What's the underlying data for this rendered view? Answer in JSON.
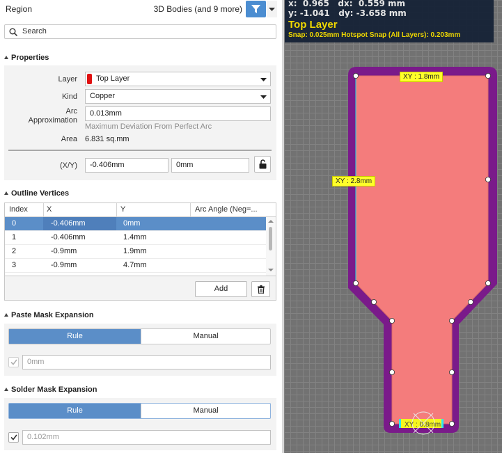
{
  "header": {
    "title": "Region",
    "filter_text": "3D Bodies (and 9 more)",
    "filter_icon": "funnel-icon"
  },
  "search": {
    "placeholder": "Search"
  },
  "properties": {
    "section_label": "Properties",
    "layer_label": "Layer",
    "layer_value": "Top Layer",
    "layer_color": "#e01010",
    "kind_label": "Kind",
    "kind_value": "Copper",
    "arc_label_1": "Arc",
    "arc_label_2": "Approximation",
    "arc_value": "0.013mm",
    "arc_hint": "Maximum Deviation From Perfect Arc",
    "area_label": "Area",
    "area_value": "6.831 sq.mm",
    "xy_label": "(X/Y)",
    "x_value": "-0.406mm",
    "y_value": "0mm"
  },
  "outline": {
    "section_label": "Outline Vertices",
    "columns": [
      "Index",
      "X",
      "Y",
      "Arc Angle (Neg=..."
    ],
    "rows": [
      {
        "index": "0",
        "x": "-0.406mm",
        "y": "0mm",
        "arc": ""
      },
      {
        "index": "1",
        "x": "-0.406mm",
        "y": "1.4mm",
        "arc": ""
      },
      {
        "index": "2",
        "x": "-0.9mm",
        "y": "1.9mm",
        "arc": ""
      },
      {
        "index": "3",
        "x": "-0.9mm",
        "y": "4.7mm",
        "arc": ""
      }
    ],
    "selected_row": 0,
    "add_label": "Add"
  },
  "paste_mask": {
    "section_label": "Paste Mask Expansion",
    "rule_label": "Rule",
    "manual_label": "Manual",
    "value_placeholder": "0mm",
    "checked": true
  },
  "solder_mask": {
    "section_label": "Solder Mask Expansion",
    "rule_label": "Rule",
    "manual_label": "Manual",
    "value_placeholder": "0.102mm",
    "checked": true
  },
  "hud": {
    "line1": "x:  0.965   dx:  0.559 mm",
    "line2": "y: -1.041   dy: -3.658 mm",
    "layer": "Top Layer",
    "snap": "Snap: 0.025mm Hotspot Snap (All Layers): 0.203mm"
  },
  "dimensions": {
    "top": "XY : 1.8mm",
    "side": "XY : 2.8mm",
    "bottom": "XY : 0.8mm"
  },
  "colors": {
    "accent": "#5b8ec8",
    "copper_fill": "#f47c7c",
    "mask_outline": "#7a1a8a",
    "hud_text": "#f0d800"
  }
}
